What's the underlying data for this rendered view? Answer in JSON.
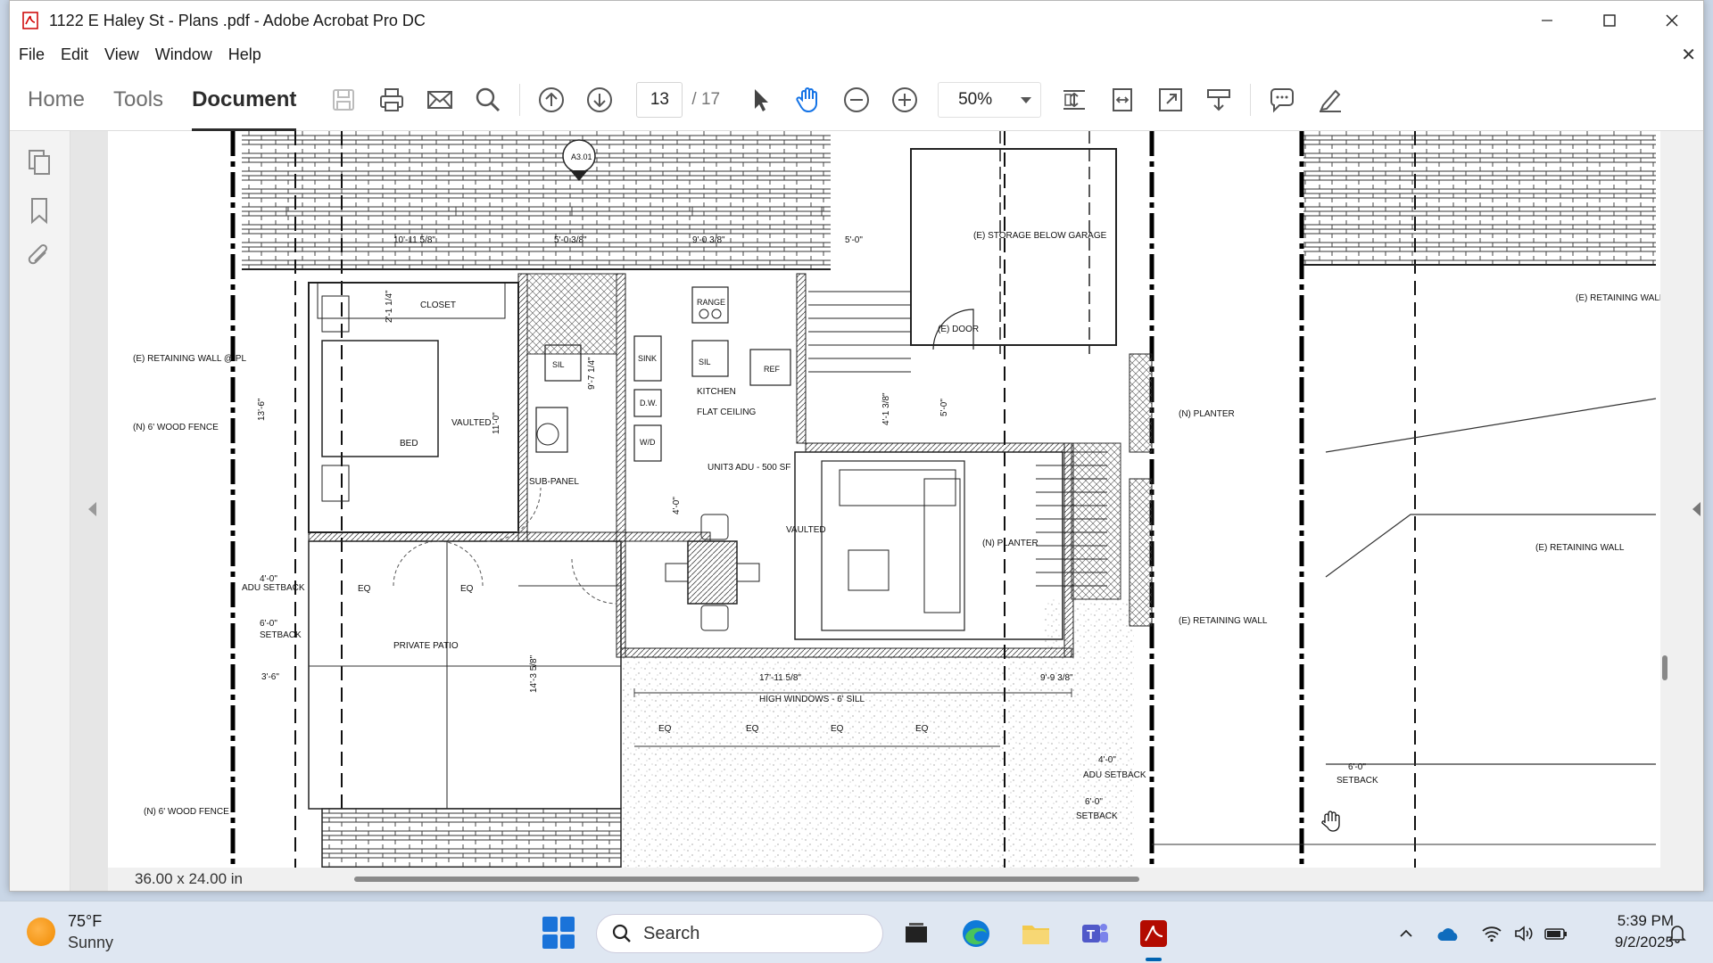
{
  "window": {
    "title": "1122 E Haley St - Plans .pdf - Adobe Acrobat Pro DC"
  },
  "menu": [
    "File",
    "Edit",
    "View",
    "Window",
    "Help"
  ],
  "tabs": [
    {
      "label": "Home",
      "active": false
    },
    {
      "label": "Tools",
      "active": false
    },
    {
      "label": "Document",
      "active": true
    }
  ],
  "toolbar": {
    "current_page": "13",
    "total_pages": "/ 17",
    "zoom": "50%"
  },
  "status": {
    "dimensions": "36.00 x 24.00 in"
  },
  "drawing": {
    "dims": [
      "10'-11 5/8\"",
      "5'-0 3/8\"",
      "9'-0 3/8\"",
      "5'-0\"",
      "2'-1 1/4\"",
      "9'-7 1/4\"",
      "4'-1 3/8\"",
      "5'-0\"",
      "13'-6\"",
      "11'-0\"",
      "3'-6\"",
      "4'-0\"",
      "6'-0\"",
      "14'-3 5/8\"",
      "17'-11 5/8\"",
      "9'-9 3/8\"",
      "4'-0\"",
      "6'-0\"",
      "6'-0\""
    ],
    "labels": {
      "section_tag": "A3.01",
      "storage": "(E) STORAGE BELOW GARAGE",
      "door": "(E) DOOR",
      "closet": "CLOSET",
      "range": "RANGE",
      "sink": "SINK",
      "sil": "SIL",
      "ref": "REF",
      "kitchen": "KITCHEN",
      "flat_ceiling": "FLAT CEILING",
      "dw": "D.W.",
      "wd": "W/D",
      "bed": "BED",
      "vaulted": "VAULTED",
      "vaulted2": "VAULTED",
      "sub_panel": "SUB-PANEL",
      "unit": "UNIT3 ADU - 500 SF",
      "retaining_wall_pl": "(E) RETAINING WALL @ PL",
      "wood_fence": "(N) 6' WOOD FENCE",
      "wood_fence2": "(N) 6' WOOD FENCE",
      "adu_setback": "ADU SETBACK",
      "adu_setback2": "ADU SETBACK",
      "setback": "SETBACK",
      "setback2": "SETBACK",
      "setback3": "SETBACK",
      "private_patio": "PRIVATE PATIO",
      "eq": "EQ",
      "planter1": "(N) PLANTER",
      "planter2": "(N) PLANTER",
      "retaining_wall": "(E) RETAINING WALL",
      "retaining_wall2": "(E) RETAINING WALL",
      "retaining_wall3": "(E) RETAINING WALL",
      "high_windows": "HIGH WINDOWS - 6' SILL"
    }
  },
  "taskbar": {
    "weather_temp": "75°F",
    "weather_cond": "Sunny",
    "search_placeholder": "Search",
    "time": "5:39 PM",
    "date": "9/2/2025"
  }
}
